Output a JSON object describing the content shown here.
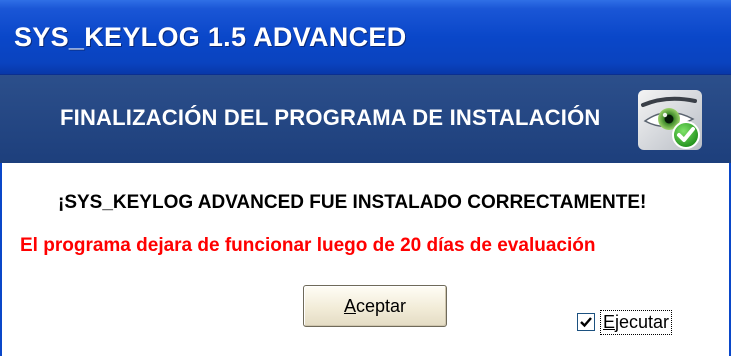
{
  "window": {
    "title": "SYS_KEYLOG 1.5 ADVANCED"
  },
  "header": {
    "title": "FINALIZACIÓN DEL PROGRAMA DE INSTALACIÓN",
    "icon": "eye-check-icon"
  },
  "messages": {
    "success": "¡SYS_KEYLOG ADVANCED FUE INSTALADO CORRECTAMENTE!",
    "warning": "El programa dejara de funcionar luego de 20 días de evaluación"
  },
  "buttons": {
    "accept_mnemonic": "A",
    "accept_rest": "ceptar"
  },
  "options": {
    "run_mnemonic": "E",
    "run_rest": "jecutar",
    "run_checked": true
  },
  "colors": {
    "title_bar": "#0a47c9",
    "header_band": "#1d3f7c",
    "warning_text": "#ff0000"
  }
}
